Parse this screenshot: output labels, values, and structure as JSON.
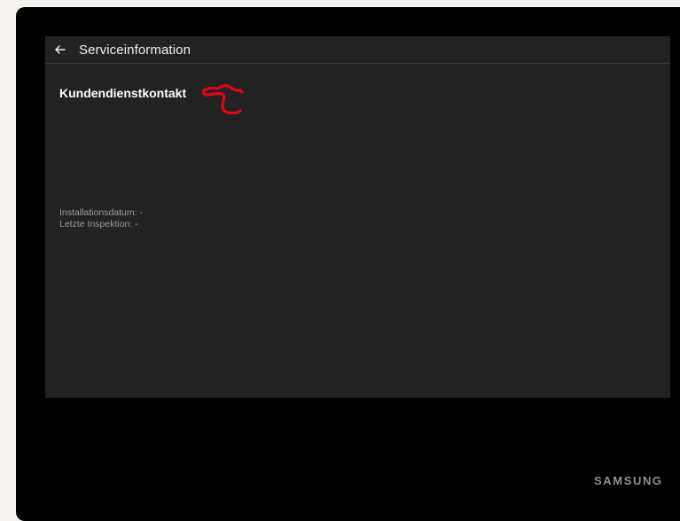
{
  "header": {
    "title": "Serviceinformation",
    "back_icon": "arrow-left-icon"
  },
  "content": {
    "section_title": "Kundendienstkontakt",
    "installation_date": "Installationsdatum: -",
    "last_inspection": "Letzte Inspektion: -"
  },
  "annotation": {
    "icon": "pointing-hand-icon",
    "color": "#e8001c"
  },
  "device": {
    "brand": "SAMSUNG"
  },
  "colors": {
    "screen_bg": "#222222",
    "bezel": "#000000",
    "page_bg": "#f3f2ee",
    "text_primary": "#f0f0f0",
    "text_secondary": "#9d9d9d"
  }
}
